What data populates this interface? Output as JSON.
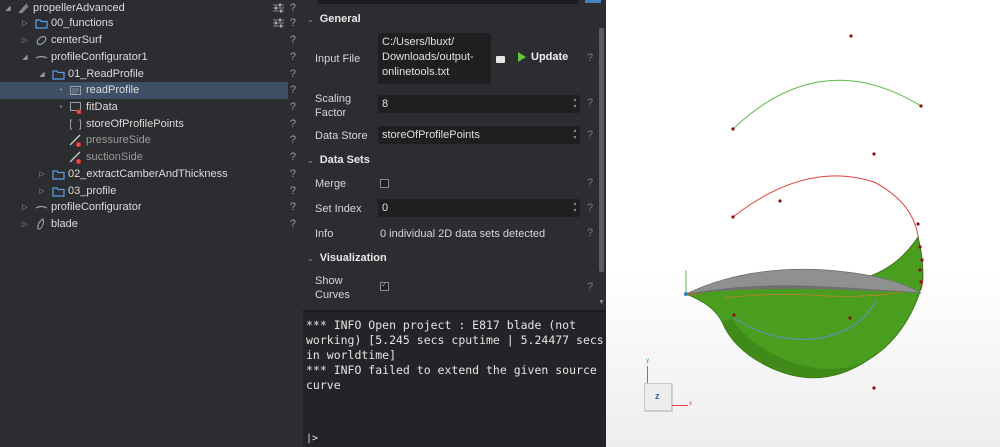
{
  "tree": {
    "items": [
      {
        "label": "propellerAdvanced"
      },
      {
        "label": "00_functions"
      },
      {
        "label": "centerSurf"
      },
      {
        "label": "profileConfigurator1"
      },
      {
        "label": "01_ReadProfile"
      },
      {
        "label": "readProfile"
      },
      {
        "label": "fitData"
      },
      {
        "label": "storeOfProfilePoints"
      },
      {
        "label": "pressureSide"
      },
      {
        "label": "suctionSide"
      },
      {
        "label": "02_extractCamberAndThickness"
      },
      {
        "label": "03_profile"
      },
      {
        "label": "profileConfigurator"
      },
      {
        "label": "blade"
      }
    ],
    "help": "?",
    "warn": "!"
  },
  "props": {
    "general": {
      "title": "General",
      "input_file_label": "Input File",
      "input_file_lines": [
        "C:/Users/lbuxt/",
        "Downloads/output-",
        "onlinetools.txt"
      ],
      "update_label": "Update",
      "scaling_factor_label_1": "Scaling",
      "scaling_factor_label_2": "Factor",
      "scaling_factor_value": "8",
      "data_store_label": "Data Store",
      "data_store_value": "storeOfProfilePoints"
    },
    "data_sets": {
      "title": "Data Sets",
      "merge_label": "Merge",
      "set_index_label": "Set Index",
      "set_index_value": "0",
      "info_label": "Info",
      "info_value": "0 individual  2D data sets detected"
    },
    "visualization": {
      "title": "Visualization",
      "show_curves_label_1": "Show",
      "show_curves_label_2": "Curves",
      "show_curves_checked": true
    },
    "help": "?"
  },
  "console": {
    "lines": [
      "*** INFO Open project : E817 blade (not",
      "working) [5.245 secs cputime | 5.24477 secs",
      "in worldtime]",
      "*** INFO failed to extend the given source",
      "curve"
    ],
    "prompt": "|>"
  },
  "viewport": {
    "axis_z": "z",
    "axis_x": "x",
    "axis_y": "y",
    "colors": {
      "green_curve": "#6fbf5c",
      "red_curve": "#e0433f",
      "blade_green": "#4a9e1f",
      "blade_dark": "#2f6e12",
      "blade_gray": "#8f9191",
      "point": "#8b1010"
    }
  }
}
